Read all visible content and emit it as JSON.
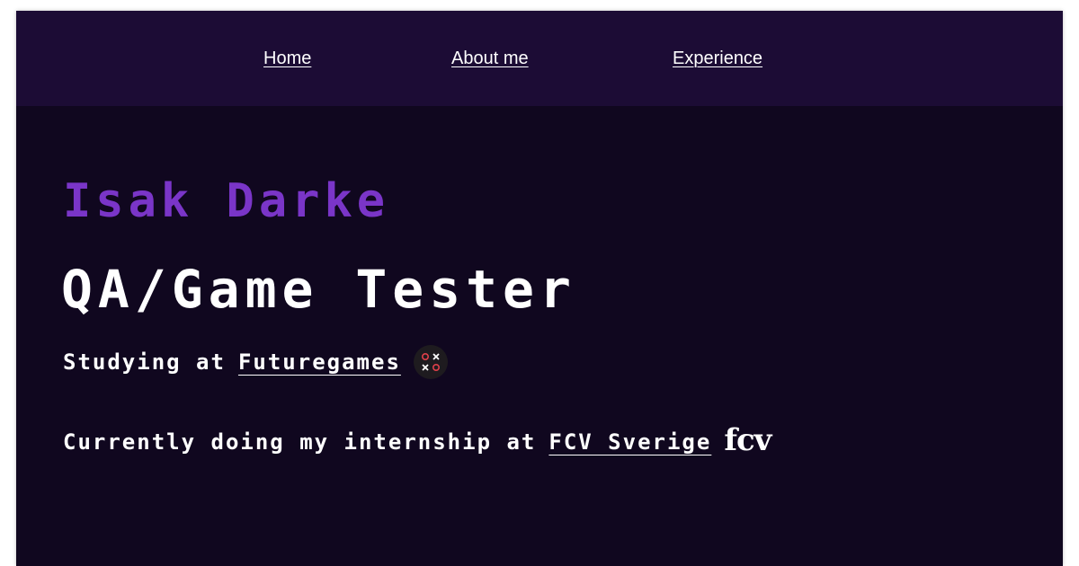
{
  "nav": {
    "items": [
      {
        "label": "Home"
      },
      {
        "label": "About me"
      },
      {
        "label": "Experience"
      }
    ]
  },
  "hero": {
    "name": "Isak Darke",
    "role": "QA/Game Tester",
    "study_prefix": "Studying at",
    "study_link": "Futuregames",
    "study_logo_icon": "futuregames-logo-icon",
    "intern_prefix": "Currently doing my internship at",
    "intern_link": "FCV Sverige",
    "intern_logo_text": "fcv"
  },
  "colors": {
    "background": "#10071f",
    "nav_background": "#1c0c35",
    "accent": "#7a35c8",
    "text": "#ffffff"
  }
}
